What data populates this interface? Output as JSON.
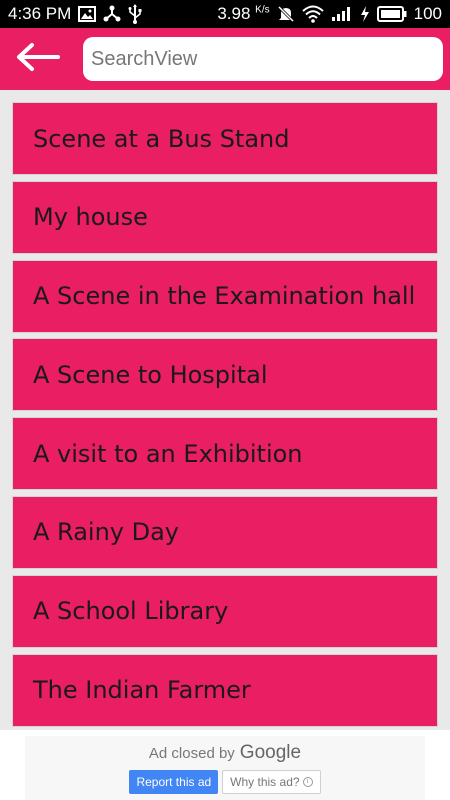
{
  "status_bar": {
    "time": "4:36 PM",
    "speed": "3.98",
    "speed_unit": "K/s",
    "battery": "100",
    "icons": [
      "image-icon",
      "share-icon",
      "usb-icon",
      "mute-icon",
      "wifi-icon",
      "signal-icon",
      "charging-icon",
      "battery-icon"
    ]
  },
  "toolbar": {
    "back_icon": "arrow-back-icon",
    "search_placeholder": "SearchView",
    "color": "#e91e63"
  },
  "list": {
    "items": [
      {
        "label": "Scene at a Bus Stand"
      },
      {
        "label": "My house"
      },
      {
        "label": "A Scene in the Examination hall"
      },
      {
        "label": "A Scene to Hospital"
      },
      {
        "label": "A visit to an Exhibition"
      },
      {
        "label": "A Rainy Day"
      },
      {
        "label": "A School Library"
      },
      {
        "label": "The Indian Farmer"
      }
    ]
  },
  "ad": {
    "closed_text": "Ad closed by",
    "google_text": "Google",
    "report_label": "Report this ad",
    "why_label": "Why this ad?",
    "report_color": "#4285f4"
  }
}
